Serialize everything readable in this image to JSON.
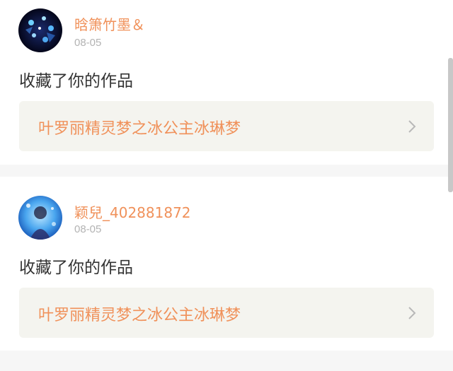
{
  "notifications": [
    {
      "username": "晗箫竹墨＆",
      "date": "08-05",
      "action": "收藏了你的作品",
      "work_title": "叶罗丽精灵梦之冰公主冰琳梦"
    },
    {
      "username": "颖兒_402881872",
      "date": "08-05",
      "action": "收藏了你的作品",
      "work_title": "叶罗丽精灵梦之冰公主冰琳梦"
    }
  ],
  "icons": {
    "chevron": "chevron-right-icon"
  },
  "colors": {
    "accent": "#f0915a",
    "muted": "#b3b3b3",
    "text": "#333333",
    "link_bg": "#f4f4ef",
    "page_bg": "#f6f6f6"
  }
}
